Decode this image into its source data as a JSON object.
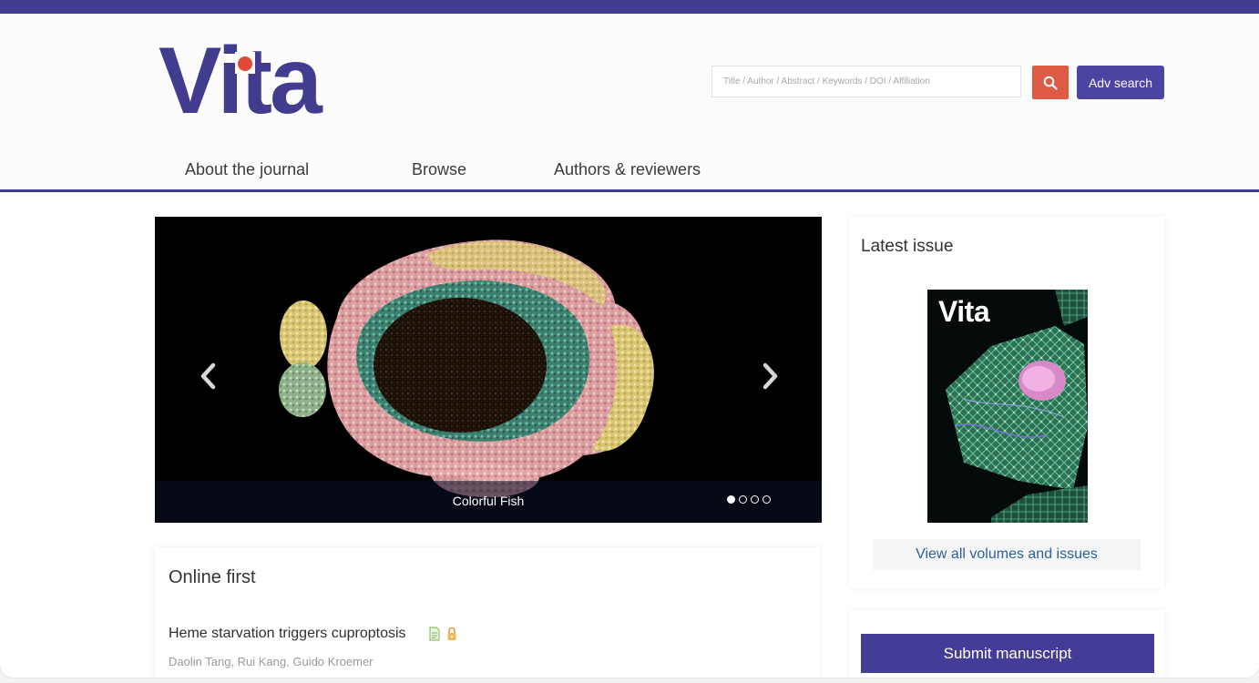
{
  "header": {
    "logo_text": "Vita",
    "search": {
      "placeholder": "Title / Author / Abstract / Keywords / DOI / Affiliation",
      "button_icon": "search-icon"
    },
    "adv_search_label": "Adv search"
  },
  "nav": {
    "items": [
      {
        "label": "About the journal"
      },
      {
        "label": "Browse"
      },
      {
        "label": "Authors & reviewers"
      }
    ]
  },
  "carousel": {
    "caption": "Colorful Fish",
    "slide_count": 4,
    "active_index": 0,
    "prev_icon": "chevron-left-icon",
    "next_icon": "chevron-right-icon"
  },
  "online_first": {
    "title": "Online first",
    "articles": [
      {
        "title": "Heme starvation triggers cuproptosis",
        "authors": "Daolin Tang, Rui Kang, Guido Kroemer",
        "icons": [
          "document-icon",
          "lock-icon"
        ]
      }
    ]
  },
  "sidebar": {
    "latest_issue_title": "Latest issue",
    "cover_title": "Vita",
    "view_all_label": "View all volumes and issues",
    "submit_label": "Submit manuscript"
  },
  "colors": {
    "brand": "#423c8f",
    "accent_red": "#dd5b45",
    "link": "#2c5f9a"
  }
}
